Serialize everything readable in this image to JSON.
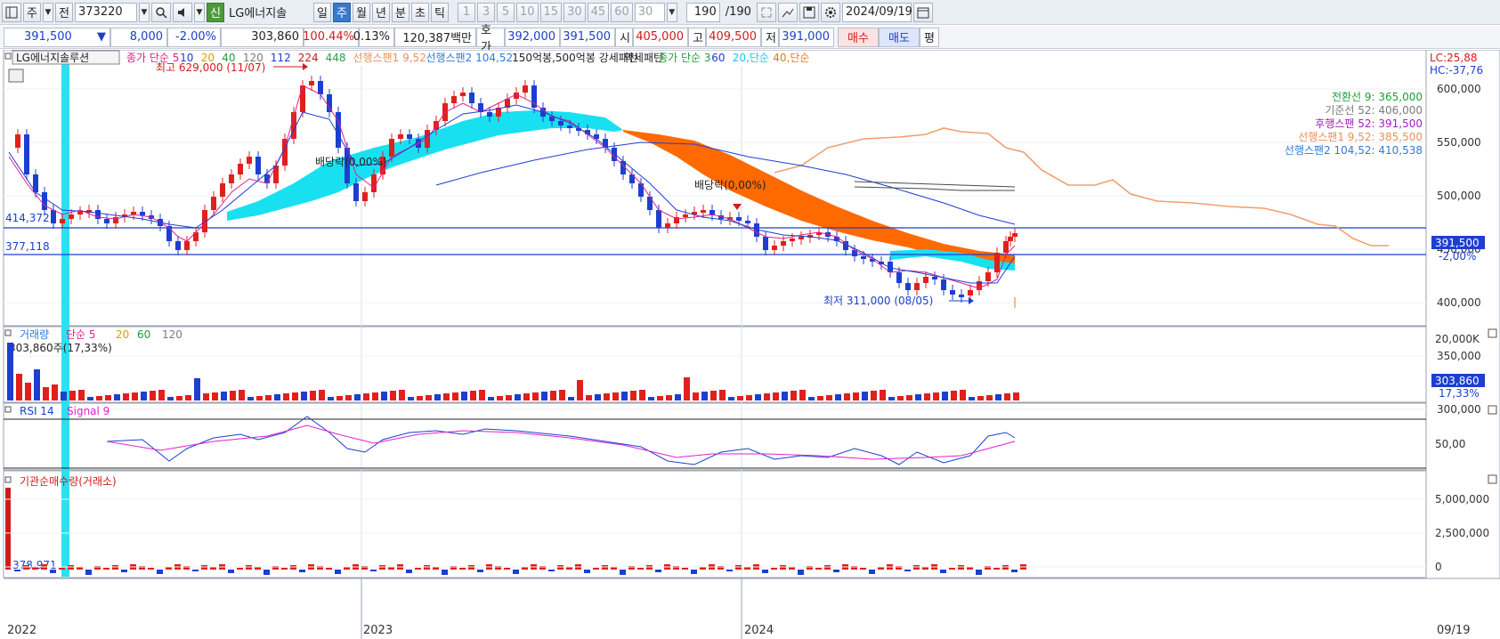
{
  "toolbar": {
    "period_type": "주",
    "prev_label": "전",
    "stock_code": "373220",
    "badge_new": "신",
    "stock_name": "LG에너지솔",
    "tabs": [
      "일",
      "주",
      "월",
      "년",
      "분",
      "초",
      "틱"
    ],
    "active_tab": "주",
    "intervals": [
      "1",
      "3",
      "5",
      "10",
      "15",
      "30",
      "45",
      "60"
    ],
    "interval_select": "30",
    "count_value": "190",
    "count_total": "/190",
    "date_value": "2024/09/19"
  },
  "quote": {
    "price": "391,500",
    "change_arrow": "▼",
    "change": "8,000",
    "change_pct": "-2.00%",
    "volume": "303,860",
    "volume_ratio": "100.44%",
    "turnover_pct": "0.13%",
    "trade_value": "120,387백만",
    "ask_label": "호가",
    "ask": "392,000",
    "bid": "391,500",
    "open_label": "시",
    "open": "405,000",
    "high_label": "고",
    "high": "409,500",
    "low_label": "저",
    "low": "391,000",
    "buy_label": "매수",
    "sell_label": "매도",
    "eval_label": "평"
  },
  "main_panel": {
    "stock_tag": "LG에너지솔루션",
    "legend": [
      {
        "text": "종가 단순 5",
        "color": "#e0208c"
      },
      {
        "text": "10",
        "color": "#1d3fd1"
      },
      {
        "text": "20",
        "color": "#d6a300"
      },
      {
        "text": "40",
        "color": "#1e9e3a"
      },
      {
        "text": "120",
        "color": "#7b7b7b"
      },
      {
        "text": "112",
        "color": "#1d3fd1"
      },
      {
        "text": "224",
        "color": "#c21c1c"
      },
      {
        "text": "448",
        "color": "#2aa04a"
      },
      {
        "text": "선행스팬1 9,52",
        "color": "#e8915a"
      },
      {
        "text": "선행스팬2 104,52",
        "color": "#2f7bd6"
      },
      {
        "text": "150억봉,500억봉 강세패턴",
        "color": "#222222"
      },
      {
        "text": "약세패턴",
        "color": "#222222"
      },
      {
        "text": "종가 단순 3",
        "color": "#1e9e3a"
      },
      {
        "text": "60",
        "color": "#1d3fd1"
      },
      {
        "text": "20,단순",
        "color": "#19c8e8"
      },
      {
        "text": "40,단순",
        "color": "#e07b1a"
      }
    ],
    "lc": "LC:25,88",
    "hc": "HC:-37,76",
    "high_note": "최고 629,000 (11/07)",
    "low_note": "최저 311,000 (08/05)",
    "dividend_1": "배당락(0,00%)",
    "dividend_2": "배당락(0,00%)",
    "hline_upper": "414,372",
    "hline_lower": "377,118",
    "y_axis": [
      "600,000",
      "550,000",
      "500,000",
      "450,000",
      "400,000",
      "350,000",
      "300,000"
    ],
    "price_tag": "391,500",
    "pct_tag": "-2,00%",
    "ichimoku_labels": [
      {
        "text": "전환선 9: 365,000",
        "color": "#1e9e3a"
      },
      {
        "text": "기준선 52: 406,000",
        "color": "#7b7b7b"
      },
      {
        "text": "후행스팬 52: 391,500",
        "color": "#a020c0"
      },
      {
        "text": "선행스팬1 9,52: 385,500",
        "color": "#e8915a"
      },
      {
        "text": "선행스팬2 104,52: 410,538",
        "color": "#2f7bd6"
      }
    ]
  },
  "volume_panel": {
    "legend_name": "거래량",
    "legend_ma": "단순 5",
    "legend_20": "20",
    "legend_60": "60",
    "legend_120": "120",
    "current": "303,860주(17,33%)",
    "y_top": "20,000K",
    "value_tag": "303,860",
    "pct_tag": "17,33%"
  },
  "rsi_panel": {
    "legend_rsi": "RSI 14",
    "legend_signal": "Signal 9",
    "y_mid": "50,00"
  },
  "inst_panel": {
    "title": "기관순매수량(거래소)",
    "current": "378,971",
    "y_axis": [
      "5,000,000",
      "2,500,000",
      "0"
    ]
  },
  "x_axis": [
    "2022",
    "2023",
    "2024"
  ],
  "x_axis_right": "09/19",
  "colors": {
    "up": "#e0201c",
    "down": "#1d3fd1",
    "cloud_bull": "#19e0f0",
    "cloud_bear": "#ff6a00",
    "highlight": "#2ee0ef"
  }
}
